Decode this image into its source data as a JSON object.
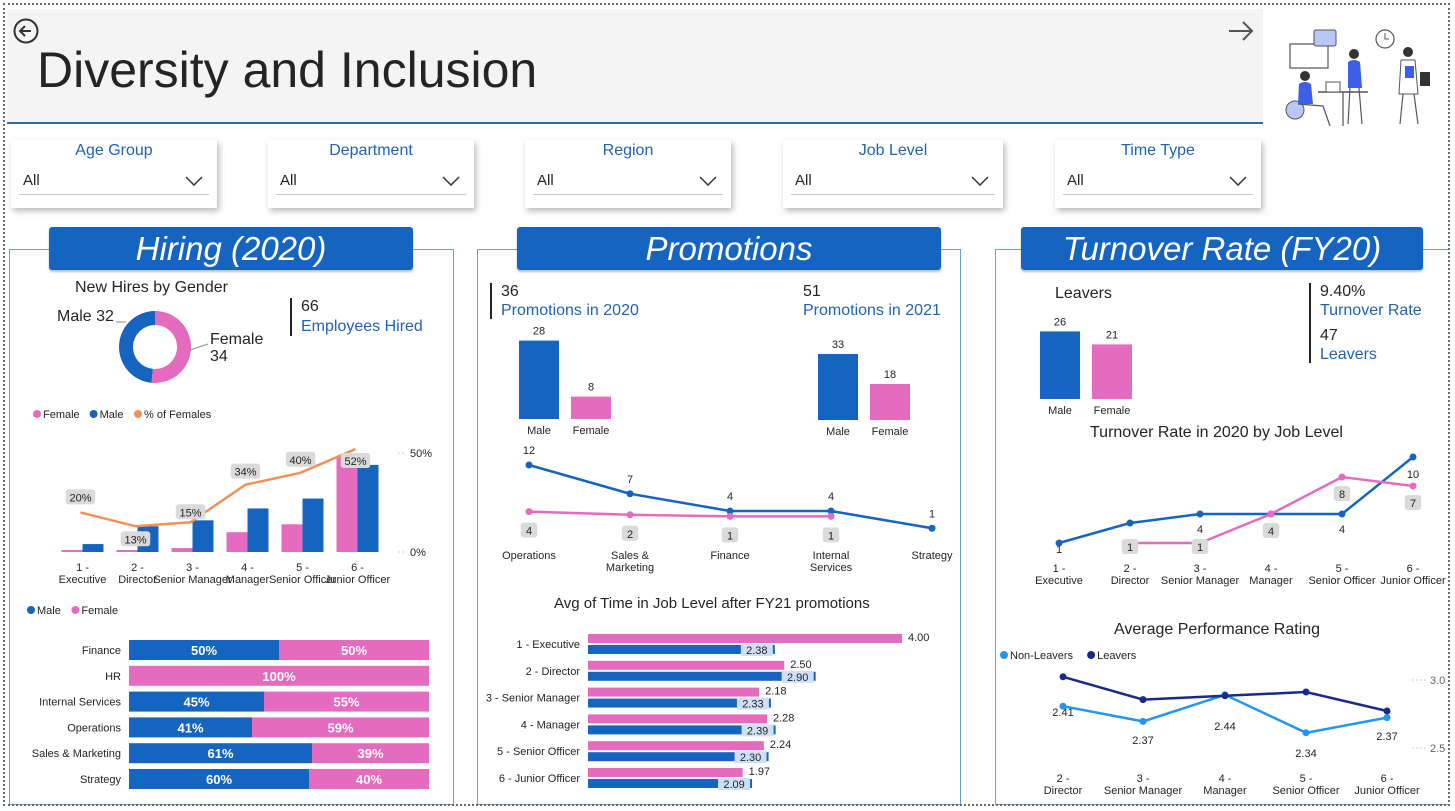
{
  "page": {
    "title": "Diversity and Inclusion"
  },
  "colors": {
    "male": "#1565c0",
    "female": "#e56bbf",
    "pct_line": "#f0915a",
    "non_leavers": "#2196f3",
    "leavers": "#1a2a8c",
    "accent": "#1f63b5"
  },
  "icons": {
    "back": "back-arrow-icon",
    "next": "next-arrow-icon",
    "illustration": "office-people-illustration"
  },
  "filters": [
    {
      "label": "Age Group",
      "value": "All"
    },
    {
      "label": "Department",
      "value": "All"
    },
    {
      "label": "Region",
      "value": "All"
    },
    {
      "label": "Job Level",
      "value": "All"
    },
    {
      "label": "Time Type",
      "value": "All"
    }
  ],
  "hiring": {
    "banner": "Hiring (2020)",
    "donut_title": "New Hires by Gender",
    "male_label": "Male 32",
    "female_label": "Female",
    "female_count": "34",
    "kpi_value": "66",
    "kpi_label": "Employees Hired",
    "legend": [
      "Female",
      "Male",
      "% of Females"
    ],
    "legend2": [
      "Male",
      "Female"
    ]
  },
  "promotions": {
    "banner": "Promotions",
    "kpi_2020_value": "36",
    "kpi_2020_label": "Promotions in 2020",
    "kpi_2021_value": "51",
    "kpi_2021_label": "Promotions in 2021",
    "time_title": "Avg of Time in Job Level after FY21 promotions"
  },
  "turnover": {
    "banner": "Turnover Rate (FY20)",
    "leavers_title": "Leavers",
    "rate_value": "9.40%",
    "rate_label": "Turnover Rate",
    "leavers_value": "47",
    "leavers_label": "Leavers",
    "line_title": "Turnover Rate in 2020 by Job Level",
    "perf_title": "Average Performance Rating",
    "perf_legend": [
      "Non-Leavers",
      "Leavers"
    ]
  },
  "chart_data": [
    {
      "id": "new_hires_donut",
      "type": "pie",
      "title": "New Hires by Gender",
      "categories": [
        "Male",
        "Female"
      ],
      "values": [
        32,
        34
      ]
    },
    {
      "id": "hires_by_level",
      "type": "bar",
      "categories": [
        "1 - Executive",
        "2 - Director",
        "3 - Senior Manager",
        "4 - Manager",
        "5 - Senior Officer",
        "6 - Junior Officer"
      ],
      "series": [
        {
          "name": "Female",
          "values": [
            1,
            1,
            2,
            10,
            14,
            48
          ]
        },
        {
          "name": "Male",
          "values": [
            4,
            13,
            16,
            22,
            27,
            44
          ]
        },
        {
          "name": "% of Females",
          "values": [
            20,
            13,
            15,
            34,
            40,
            52
          ]
        }
      ],
      "y2_ticks": [
        "50%",
        "0%"
      ]
    },
    {
      "id": "dept_gender",
      "type": "bar",
      "orientation": "horizontal",
      "stacked": "100%",
      "categories": [
        "Finance",
        "HR",
        "Internal Services",
        "Operations",
        "Sales & Marketing",
        "Strategy"
      ],
      "series": [
        {
          "name": "Male",
          "values": [
            50,
            0,
            45,
            41,
            61,
            60
          ]
        },
        {
          "name": "Female",
          "values": [
            50,
            100,
            55,
            59,
            39,
            40
          ]
        }
      ]
    },
    {
      "id": "promo_2020_gender",
      "type": "bar",
      "categories": [
        "Male",
        "Female"
      ],
      "values": [
        28,
        8
      ]
    },
    {
      "id": "promo_2021_gender",
      "type": "bar",
      "categories": [
        "Male",
        "Female"
      ],
      "values": [
        33,
        18
      ]
    },
    {
      "id": "promo_by_dept",
      "type": "line",
      "categories": [
        "Operations",
        "Sales & Marketing",
        "Finance",
        "Internal Services",
        "Strategy"
      ],
      "series": [
        {
          "name": "Male",
          "values": [
            12,
            7,
            4,
            4,
            1
          ]
        },
        {
          "name": "Female",
          "values": [
            4,
            2,
            1,
            1,
            null
          ]
        }
      ]
    },
    {
      "id": "time_in_level",
      "type": "bar",
      "orientation": "horizontal",
      "title": "Avg of Time in Job Level after FY21 promotions",
      "categories": [
        "1 - Executive",
        "2 - Director",
        "3 - Senior Manager",
        "4 - Manager",
        "5 - Senior Officer",
        "6 - Junior Officer"
      ],
      "series": [
        {
          "name": "Female",
          "values": [
            4.0,
            2.5,
            2.18,
            2.28,
            2.24,
            1.97
          ]
        },
        {
          "name": "Male",
          "values": [
            2.38,
            2.9,
            2.33,
            2.39,
            2.3,
            2.09
          ]
        }
      ],
      "labels": {
        "Female": [
          "4.00",
          "2.50",
          "2.18",
          "2.28",
          "2.24",
          "1.97"
        ],
        "Male": [
          "2.38",
          "2.90",
          "2.33",
          "2.39",
          "2.30",
          "2.09"
        ]
      }
    },
    {
      "id": "leavers_gender",
      "type": "bar",
      "title": "Leavers",
      "categories": [
        "Male",
        "Female"
      ],
      "values": [
        26,
        21
      ]
    },
    {
      "id": "turnover_by_level",
      "type": "line",
      "title": "Turnover Rate in 2020 by Job Level",
      "categories": [
        "1 - Executive",
        "2 - Director",
        "3 - Senior Manager",
        "4 - Manager",
        "5 - Senior Officer",
        "6 - Junior Officer"
      ],
      "series": [
        {
          "name": "Male",
          "values": [
            1,
            3,
            4,
            4,
            4,
            10
          ]
        },
        {
          "name": "Female",
          "values": [
            null,
            1,
            1,
            4,
            8,
            7
          ]
        }
      ]
    },
    {
      "id": "perf_rating",
      "type": "line",
      "title": "Average Performance Rating",
      "categories": [
        "2 - Director",
        "3 - Senior Manager",
        "4 - Manager",
        "5 - Senior Officer",
        "6 - Junior Officer"
      ],
      "series": [
        {
          "name": "Non-Leavers",
          "values": [
            2.41,
            2.37,
            2.44,
            2.34,
            2.38
          ]
        },
        {
          "name": "Leavers",
          "values": [
            2.44,
            2.38,
            2.39,
            2.4,
            2.35
          ]
        }
      ],
      "point_labels": [
        "2.41",
        "2.37",
        "2.44",
        "2.34",
        "2.37"
      ],
      "y_ticks": [
        "3.0",
        "2.5"
      ]
    }
  ]
}
